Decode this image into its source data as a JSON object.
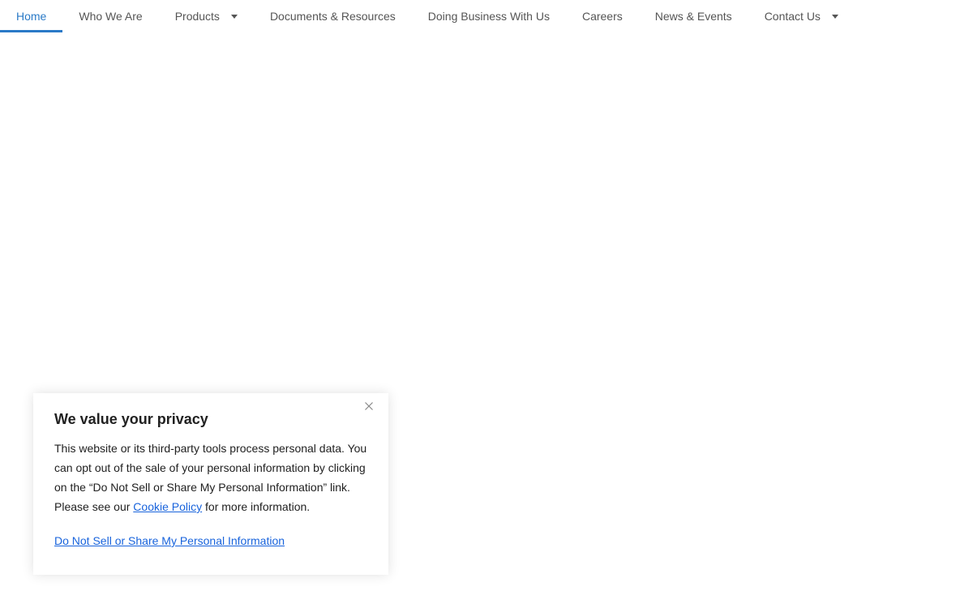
{
  "nav": {
    "items": [
      {
        "label": "Home",
        "active": true,
        "dropdown": false
      },
      {
        "label": "Who We Are",
        "active": false,
        "dropdown": false
      },
      {
        "label": "Products",
        "active": false,
        "dropdown": true
      },
      {
        "label": "Documents & Resources",
        "active": false,
        "dropdown": false
      },
      {
        "label": "Doing Business With Us",
        "active": false,
        "dropdown": false
      },
      {
        "label": "Careers",
        "active": false,
        "dropdown": false
      },
      {
        "label": "News & Events",
        "active": false,
        "dropdown": false
      },
      {
        "label": "Contact Us",
        "active": false,
        "dropdown": true
      }
    ],
    "active_color": "#2a7ac7",
    "text_color": "#555555"
  },
  "consent": {
    "title": "We value your privacy",
    "body_before_link": "This website or its third-party tools process personal data. You can opt out of the sale of your personal information by clicking on the “Do Not Sell or Share My Personal Information” link. Please see our ",
    "cookie_policy_label": "Cookie Policy",
    "body_after_link": " for more information.",
    "do_not_sell_label": "Do Not Sell or Share My Personal Information",
    "close_icon": "close-icon",
    "link_color": "#1863dc"
  }
}
